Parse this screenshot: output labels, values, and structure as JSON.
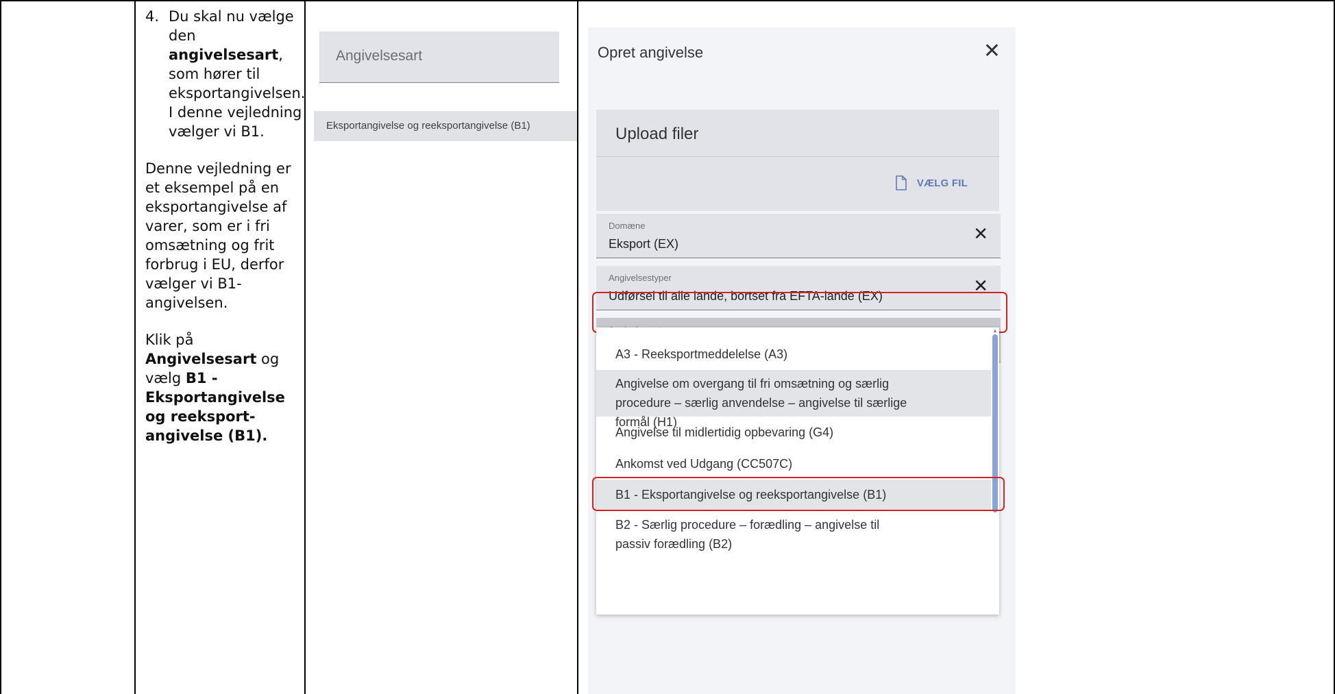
{
  "instructions": {
    "step_number": "4.",
    "step_line1": "Du skal nu vælge den",
    "step_bold": "angivelsesart",
    "step_line2": ", som hører til eksportangivelsen. I denne vejledning vælger vi B1.",
    "para2": "Denne vejledning er et eksempel på en eksportangivelse af varer, som er i fri omsætning og frit forbrug i EU, derfor vælger vi B1-angivelsen.",
    "para3_prefix": "Klik på ",
    "para3_bold1": "Angivelsesart",
    "para3_mid": " og vælg ",
    "para3_bold2": "B1 - Eksportangivelse og reeksport-angivelse (B1)."
  },
  "middle": {
    "field_placeholder": "Angivelsesart",
    "selected_option": "Eksportangivelse og reeksportangivelse (B1)"
  },
  "dialog": {
    "title": "Opret angivelse",
    "close_icon": "close-icon",
    "upload": {
      "title": "Upload filer",
      "button": "VÆLG FIL",
      "icon": "file-icon"
    },
    "fields": [
      {
        "label": "Domæne",
        "value": "Eksport (EX)"
      },
      {
        "label": "Angivelsestyper",
        "value": "Udførsel til alle lande, bortset fra EFTA-lande (EX)"
      },
      {
        "label": "Angivelsesart",
        "value": ""
      }
    ],
    "options": [
      "A3 - Reeksportmeddelelse (A3)",
      "Angivelse om overgang til fri omsætning og særlig procedure – særlig anvendelse – angivelse til særlige formål (H1)",
      "Angivelse til midlertidig opbevaring (G4)",
      "Ankomst ved Udgang (CC507C)",
      "B1 - Eksportangivelse og reeksportangivelse (B1)",
      "B2 - Særlig procedure – forædling – angivelse til passiv forædling (B2)"
    ]
  },
  "colors": {
    "highlight_border": "#d5211f",
    "link_blue": "#5d7bb4",
    "field_bg": "#e2e3e8"
  }
}
